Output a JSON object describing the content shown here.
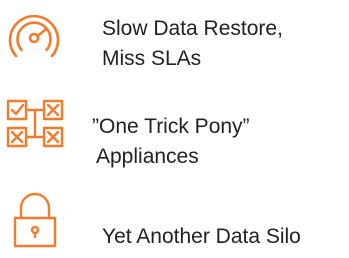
{
  "accent_color": "#F07C2E",
  "text_color": "#222222",
  "items": [
    {
      "icon": "speedometer-icon",
      "lines": [
        "Slow Data Restore,",
        "Miss SLAs"
      ]
    },
    {
      "icon": "checkbox-grid-icon",
      "lines": [
        "”One Trick Pony”",
        "Appliances"
      ]
    },
    {
      "icon": "padlock-icon",
      "lines": [
        "Yet Another Data Silo"
      ]
    }
  ]
}
